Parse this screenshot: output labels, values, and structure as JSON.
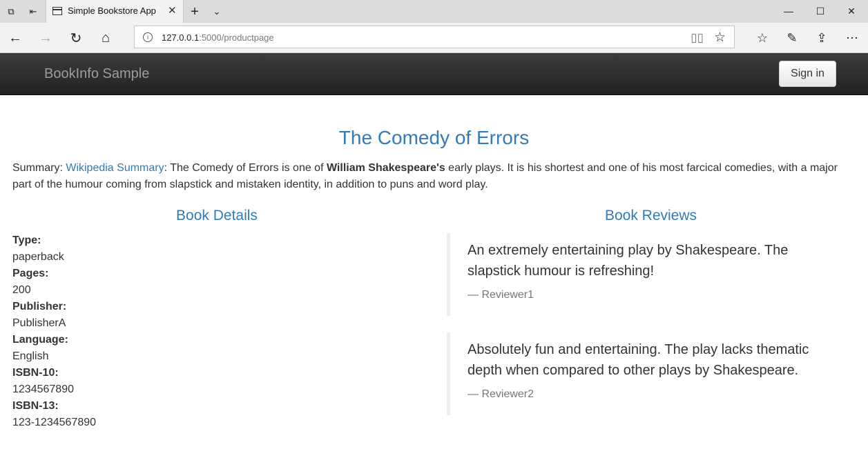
{
  "browser": {
    "tab_title": "Simple Bookstore App",
    "url_host": "127.0.0.1",
    "url_path": ":5000/productpage"
  },
  "site": {
    "brand": "BookInfo Sample",
    "signin_label": "Sign in"
  },
  "book": {
    "title": "The Comedy of Errors",
    "summary_prefix": "Summary: ",
    "summary_link": "Wikipedia Summary",
    "summary_text_1": ": The Comedy of Errors is one of ",
    "summary_bold": "William Shakespeare's",
    "summary_text_2": " early plays. It is his shortest and one of his most farcical comedies, with a major part of the humour coming from slapstick and mistaken identity, in addition to puns and word play."
  },
  "details": {
    "heading": "Book Details",
    "items": [
      {
        "label": "Type:",
        "value": "paperback"
      },
      {
        "label": "Pages:",
        "value": "200"
      },
      {
        "label": "Publisher:",
        "value": "PublisherA"
      },
      {
        "label": "Language:",
        "value": "English"
      },
      {
        "label": "ISBN-10:",
        "value": "1234567890"
      },
      {
        "label": "ISBN-13:",
        "value": "123-1234567890"
      }
    ]
  },
  "reviews": {
    "heading": "Book Reviews",
    "items": [
      {
        "text": "An extremely entertaining play by Shakespeare. The slapstick humour is refreshing!",
        "reviewer": "— Reviewer1"
      },
      {
        "text": "Absolutely fun and entertaining. The play lacks thematic depth when compared to other plays by Shakespeare.",
        "reviewer": "— Reviewer2"
      }
    ]
  }
}
